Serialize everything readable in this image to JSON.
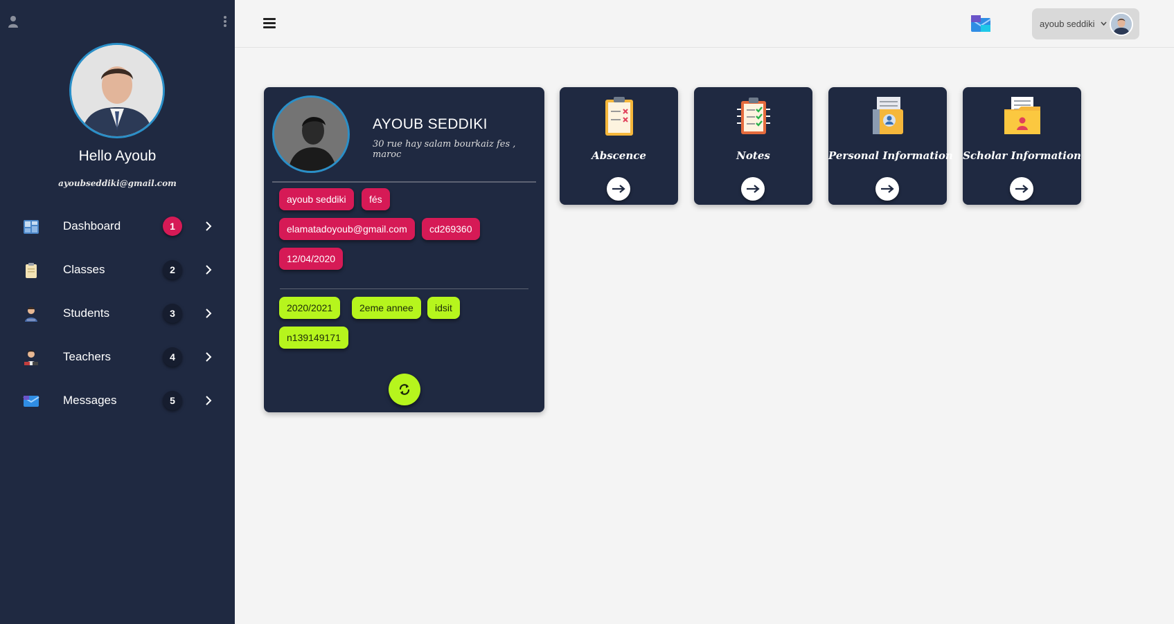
{
  "sidebar": {
    "greeting": "Hello Ayoub",
    "email": "ayoubseddiki@gmail.com",
    "items": [
      {
        "label": "Dashboard",
        "badge": "1",
        "icon": "dashboard-icon"
      },
      {
        "label": "Classes",
        "badge": "2",
        "icon": "clipboard-icon"
      },
      {
        "label": "Students",
        "badge": "3",
        "icon": "student-icon"
      },
      {
        "label": "Teachers",
        "badge": "4",
        "icon": "teacher-icon"
      },
      {
        "label": "Messages",
        "badge": "5",
        "icon": "mail-icon"
      }
    ]
  },
  "topbar": {
    "user_name": "ayoub seddiki"
  },
  "profile": {
    "name": "AYOUB SEDDIKI",
    "address": "30 rue hay salam bourkaiz fes , maroc",
    "personal_tags": [
      "ayoub seddiki",
      "fés",
      "elamatadoyoub@gmail.com",
      "cd269360",
      "12/04/2020"
    ],
    "scholar_tags": [
      "2020/2021",
      "2eme annee",
      "idsit",
      "n139149171"
    ]
  },
  "tiles": [
    {
      "label": "Abscence",
      "icon": "absence-clipboard-icon"
    },
    {
      "label": "Notes",
      "icon": "notes-checklist-icon"
    },
    {
      "label": "Personal Information",
      "icon": "personal-file-icon"
    },
    {
      "label": "Scholar Information",
      "icon": "scholar-folder-icon"
    }
  ],
  "colors": {
    "sidebar_bg": "#1f2941",
    "accent_red": "#d61a56",
    "accent_green": "#b6f51d",
    "ring_blue": "#2a8fc8"
  }
}
